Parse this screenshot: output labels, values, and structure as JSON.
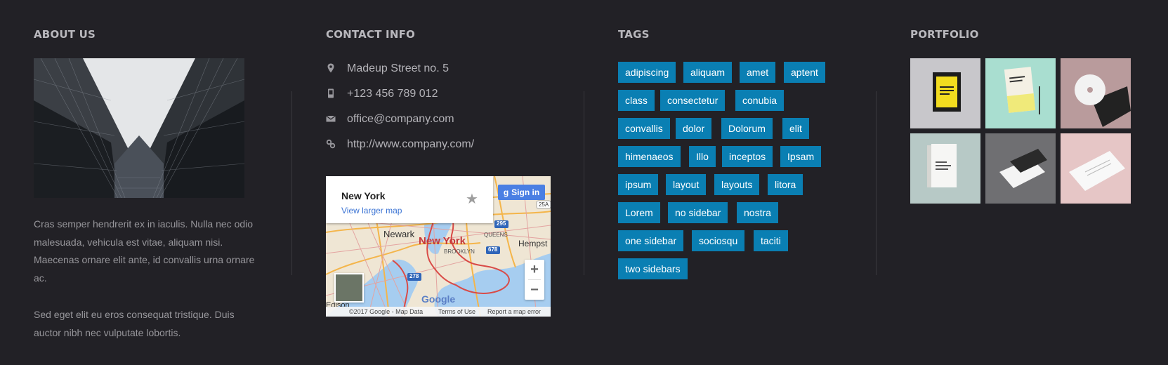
{
  "about": {
    "heading": "ABOUT US",
    "paragraph1": "Cras semper hendrerit ex in iaculis. Nulla nec odio malesuada, vehicula est vitae, aliquam nisi. Maecenas ornare elit ante, id convallis urna ornare ac.",
    "paragraph2": "Sed eget elit eu eros consequat tristique. Duis auctor nibh nec vulputate lobortis."
  },
  "contact": {
    "heading": "CONTACT INFO",
    "address": "Madeup Street no. 5",
    "phone": "+123 456 789 012",
    "email": "office@company.com",
    "website": "http://www.company.com/"
  },
  "map": {
    "place_title": "New York",
    "larger_map_link": "View larger map",
    "signin_label": "Sign in",
    "zoom_in": "+",
    "zoom_out": "−",
    "labels": {
      "newark": "Newark",
      "new_york": "New York",
      "queens": "QUEENS",
      "brooklyn": "BROOKLYN",
      "hempstead": "Hempst",
      "edison": "Edison",
      "google": "Google",
      "route_295": "295",
      "route_678": "678",
      "route_278": "278",
      "route_25a": "25A"
    },
    "footer": {
      "copyright": "©2017 Google - Map Data",
      "terms": "Terms of Use",
      "report": "Report a map error"
    }
  },
  "tags": {
    "heading": "TAGS",
    "items": [
      "adipiscing",
      "aliquam",
      "amet",
      "aptent",
      "class",
      "consectetur",
      "conubia",
      "convallis",
      "dolor",
      "Dolorum",
      "elit",
      "himenaeos",
      "Illo",
      "inceptos",
      "Ipsam",
      "ipsum",
      "layout",
      "layouts",
      "litora",
      "Lorem",
      "no sidebar",
      "nostra",
      "one sidebar",
      "sociosqu",
      "taciti",
      "two sidebars"
    ]
  },
  "portfolio": {
    "heading": "PORTFOLIO"
  },
  "colors": {
    "background": "#222126",
    "tag_background": "#0a7fb3",
    "heading_text": "#b9b8bd"
  }
}
